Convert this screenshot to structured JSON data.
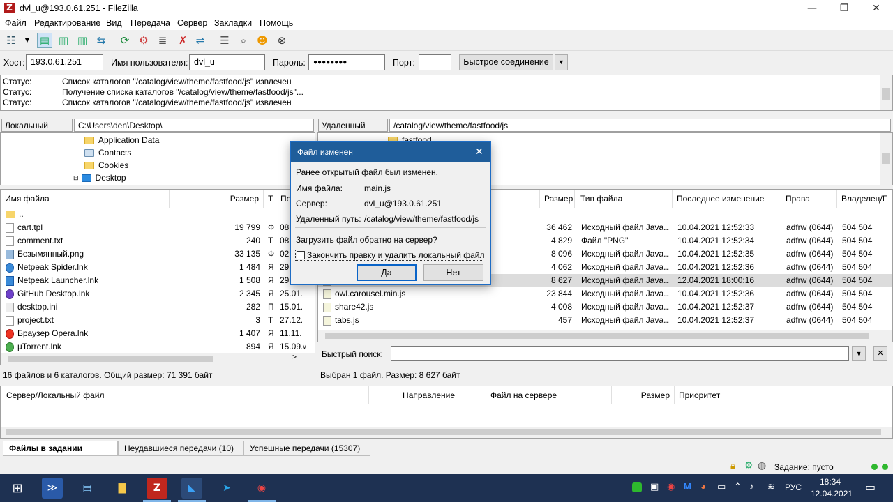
{
  "window": {
    "title": "dvl_u@193.0.61.251 - FileZilla",
    "app_icon": "Z"
  },
  "menu": [
    "Файл",
    "Редактирование",
    "Вид",
    "Передача",
    "Сервер",
    "Закладки",
    "Помощь"
  ],
  "quickconnect": {
    "host_label": "Хост:",
    "host_value": "193.0.61.251",
    "user_label": "Имя пользователя:",
    "user_value": "dvl_u",
    "pass_label": "Пароль:",
    "pass_value": "●●●●●●●●",
    "port_label": "Порт:",
    "port_value": "",
    "connect_label": "Быстрое соединение"
  },
  "log": [
    {
      "k": "Статус:",
      "v": "Список каталогов \"/catalog/view/theme/fastfood/js\" извлечен"
    },
    {
      "k": "Статус:",
      "v": "Получение списка каталогов \"/catalog/view/theme/fastfood/js\"..."
    },
    {
      "k": "Статус:",
      "v": "Список каталогов \"/catalog/view/theme/fastfood/js\" извлечен"
    }
  ],
  "local": {
    "site_label": "Локальный сайт:",
    "site_path": "C:\\Users\\den\\Desktop\\",
    "tree": [
      "Application Data",
      "Contacts",
      "Cookies",
      "Desktop"
    ],
    "headers": [
      "Имя файла",
      "Размер",
      "Т",
      "По"
    ],
    "files": [
      {
        "name": "..",
        "size": "",
        "type": "",
        "date": ""
      },
      {
        "name": "cart.tpl",
        "size": "19 799",
        "type": "Ф",
        "date": "08.0"
      },
      {
        "name": "comment.txt",
        "size": "240",
        "type": "Т",
        "date": "08.0"
      },
      {
        "name": "Безымянный.png",
        "size": "33 135",
        "type": "Ф",
        "date": "02.0"
      },
      {
        "name": "Netpeak Spider.lnk",
        "size": "1 484",
        "type": "Я",
        "date": "29.0"
      },
      {
        "name": "Netpeak Launcher.lnk",
        "size": "1 508",
        "type": "Я",
        "date": "29.0"
      },
      {
        "name": "GitHub Desktop.lnk",
        "size": "2 345",
        "type": "Я",
        "date": "25.01."
      },
      {
        "name": "desktop.ini",
        "size": "282",
        "type": "П",
        "date": "15.01."
      },
      {
        "name": "project.txt",
        "size": "3",
        "type": "Т",
        "date": "27.12."
      },
      {
        "name": "Браузер Opera.lnk",
        "size": "1 407",
        "type": "Я",
        "date": "11.11."
      },
      {
        "name": "µTorrent.lnk",
        "size": "894",
        "type": "Я",
        "date": "15.09."
      }
    ],
    "status": "16 файлов и 6 каталогов. Общий размер: 71 391 байт"
  },
  "remote": {
    "site_label": "Удаленный сайт:",
    "site_path": "/catalog/view/theme/fastfood/js",
    "tree": [
      "fastfood"
    ],
    "headers": [
      "Размер",
      "Тип файла",
      "Последнее изменение",
      "Права",
      "Владелец/Г"
    ],
    "files": [
      {
        "name": "",
        "size": "36 462",
        "type": "Исходный файл Java...",
        "date": "10.04.2021 12:52:33",
        "perm": "adfrw (0644)",
        "owner": "504 504"
      },
      {
        "name": "",
        "size": "4 829",
        "type": "Файл \"PNG\"",
        "date": "10.04.2021 12:52:34",
        "perm": "adfrw (0644)",
        "owner": "504 504"
      },
      {
        "name": "",
        "size": "8 096",
        "type": "Исходный файл Java...",
        "date": "10.04.2021 12:52:35",
        "perm": "adfrw (0644)",
        "owner": "504 504"
      },
      {
        "name": "",
        "size": "4 062",
        "type": "Исходный файл Java...",
        "date": "10.04.2021 12:52:36",
        "perm": "adfrw (0644)",
        "owner": "504 504"
      },
      {
        "name": "",
        "size": "8 627",
        "type": "Исходный файл Java...",
        "date": "12.04.2021 18:00:16",
        "perm": "adfrw (0644)",
        "owner": "504 504"
      },
      {
        "name": "owl.carousel.min.js",
        "size": "23 844",
        "type": "Исходный файл Java...",
        "date": "10.04.2021 12:52:36",
        "perm": "adfrw (0644)",
        "owner": "504 504"
      },
      {
        "name": "share42.js",
        "size": "4 008",
        "type": "Исходный файл Java...",
        "date": "10.04.2021 12:52:37",
        "perm": "adfrw (0644)",
        "owner": "504 504"
      },
      {
        "name": "tabs.js",
        "size": "457",
        "type": "Исходный файл Java...",
        "date": "10.04.2021 12:52:37",
        "perm": "adfrw (0644)",
        "owner": "504 504"
      }
    ],
    "quicksearch_label": "Быстрый поиск:",
    "status": "Выбран 1 файл. Размер: 8 627 байт"
  },
  "queue": {
    "headers": [
      "Сервер/Локальный файл",
      "Направление",
      "Файл на сервере",
      "Размер",
      "Приоритет"
    ]
  },
  "tabs": [
    "Файлы в задании",
    "Неудавшиеся передачи (10)",
    "Успешные передачи (15307)"
  ],
  "bottom_status": "Задание: пусто",
  "taskbar": {
    "lang": "РУС",
    "time": "18:34",
    "date": "12.04.2021"
  },
  "dialog": {
    "title": "Файл изменен",
    "message": "Ранее открытый файл был изменен.",
    "file_label": "Имя файла:",
    "file_value": "main.js",
    "server_label": "Сервер:",
    "server_value": "dvl_u@193.0.61.251",
    "path_label": "Удаленный путь:",
    "path_value": "/catalog/view/theme/fastfood/js",
    "question": "Загрузить файл обратно на сервер?",
    "checkbox_label": "Закончить правку и удалить локальный файл",
    "yes_label": "Да",
    "no_label": "Нет"
  }
}
